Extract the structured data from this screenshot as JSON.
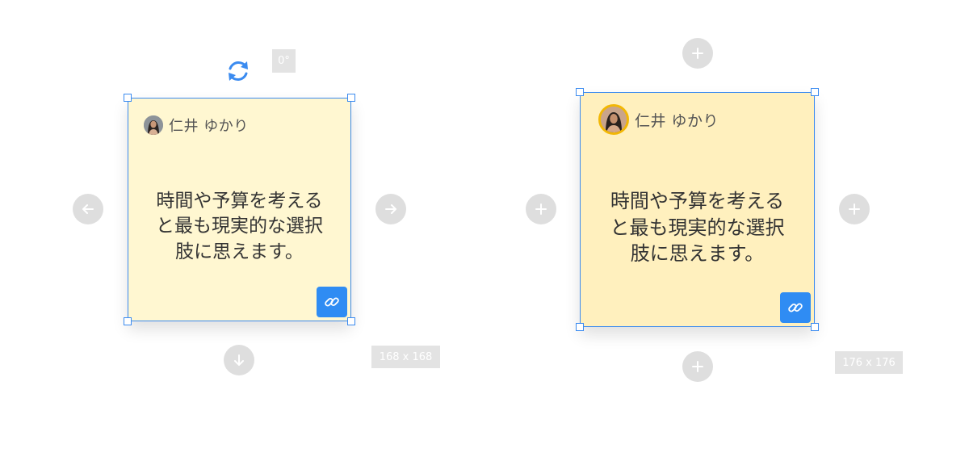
{
  "left_card": {
    "rotation_badge": "0°",
    "author_name": "仁井 ゆかり",
    "text_lines": [
      "時間や予算を考える",
      "と最も現実的な選択",
      "肢に思えます。"
    ],
    "size_badge": "168 x 168",
    "icons": {
      "rotate": "rotate-icon",
      "left": "arrow-left-icon",
      "right": "arrow-right-icon",
      "down": "arrow-down-icon",
      "link": "link-icon"
    }
  },
  "right_card": {
    "author_name": "仁井 ゆかり",
    "text_lines": [
      "時間や予算を考える",
      "と最も現実的な選択",
      "肢に思えます。"
    ],
    "size_badge": "176 x 176",
    "icons": {
      "add": "plus-icon",
      "link": "link-icon"
    }
  },
  "colors": {
    "selection_accent": "#3b8bf0",
    "left_note_bg": "#fff7d1",
    "right_note_bg": "#fff0be",
    "avatar_ring": "#f2b705",
    "control_grey": "#dedede",
    "link_button": "#2f8cf3"
  }
}
